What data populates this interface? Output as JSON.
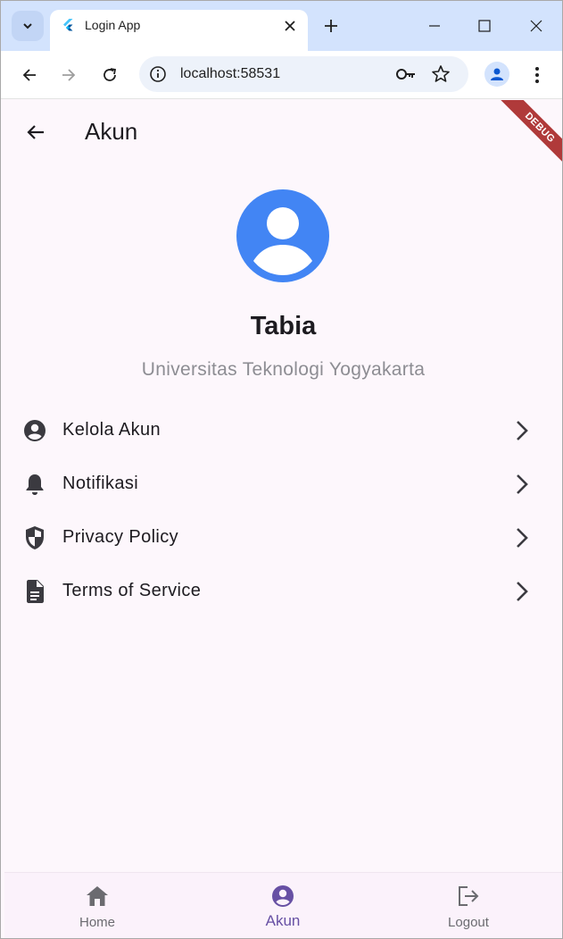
{
  "browser": {
    "tab_title": "Login App",
    "url": "localhost:58531"
  },
  "app": {
    "debug_banner": "DEBUG",
    "appbar_title": "Akun",
    "profile": {
      "name": "Tabia",
      "subtitle": "Universitas Teknologi Yogyakarta"
    },
    "menu": [
      {
        "label": "Kelola Akun",
        "icon": "account-circle-icon"
      },
      {
        "label": "Notifikasi",
        "icon": "bell-icon"
      },
      {
        "label": "Privacy Policy",
        "icon": "shield-icon"
      },
      {
        "label": "Terms of Service",
        "icon": "document-icon"
      }
    ],
    "bottom_nav": [
      {
        "label": "Home",
        "icon": "home-icon",
        "active": false
      },
      {
        "label": "Akun",
        "icon": "account-circle-icon",
        "active": true
      },
      {
        "label": "Logout",
        "icon": "logout-icon",
        "active": false
      }
    ]
  },
  "colors": {
    "accent": "#6750a4",
    "avatar": "#4285f4",
    "background": "#fdf7fc"
  }
}
